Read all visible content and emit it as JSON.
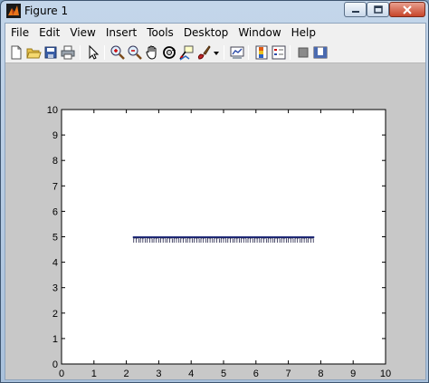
{
  "window": {
    "title": "Figure 1"
  },
  "menu": [
    "File",
    "Edit",
    "View",
    "Insert",
    "Tools",
    "Desktop",
    "Window",
    "Help"
  ],
  "toolbar": {
    "buttons": [
      "new-figure",
      "open-file",
      "save",
      "print",
      "edit-plot",
      "zoom-in",
      "zoom-out",
      "pan",
      "rotate-3d",
      "data-cursor",
      "brush",
      "link-plot",
      "colorbar",
      "legend",
      "hide-plot-tools",
      "show-plot-tools"
    ]
  },
  "chart_data": {
    "type": "line",
    "title": "",
    "xlabel": "",
    "ylabel": "",
    "xlim": [
      0,
      10
    ],
    "ylim": [
      0,
      10
    ],
    "xticks": [
      "0",
      "1",
      "2",
      "3",
      "4",
      "5",
      "6",
      "7",
      "8",
      "9",
      "10"
    ],
    "yticks": [
      "0",
      "1",
      "2",
      "3",
      "4",
      "5",
      "6",
      "7",
      "8",
      "9",
      "10"
    ],
    "grid": false,
    "series": [
      {
        "x": [
          2.2,
          7.8
        ],
        "y": [
          4.98,
          4.98
        ],
        "color": "#1f2a7a"
      }
    ],
    "annotation": {
      "text": "mmmmmmmmmmmmmmmmmmmmmmmmmmm",
      "x": 2.2,
      "y": 4.98
    }
  }
}
